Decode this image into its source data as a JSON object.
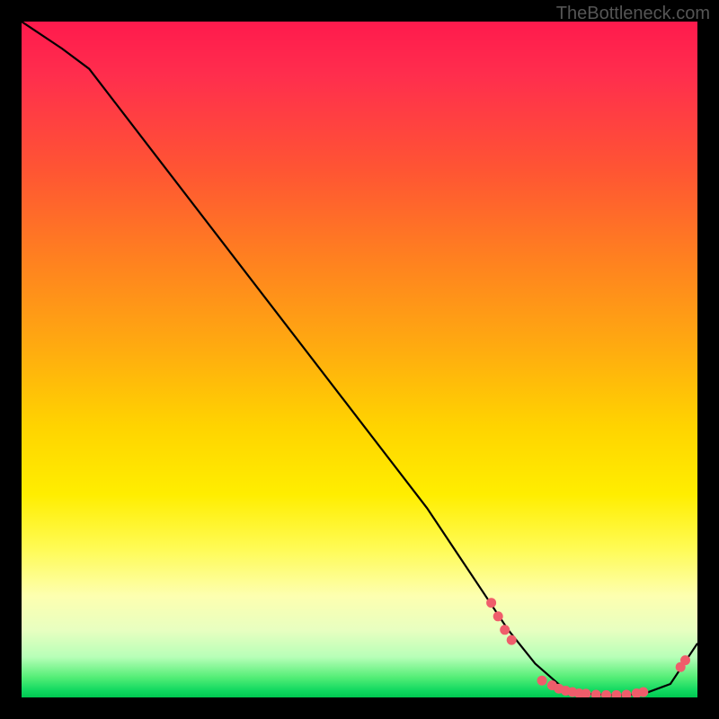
{
  "watermark": "TheBottleneck.com",
  "chart_data": {
    "type": "line",
    "title": "",
    "xlabel": "",
    "ylabel": "",
    "xlim": [
      0,
      100
    ],
    "ylim": [
      0,
      100
    ],
    "series": [
      {
        "name": "curve",
        "x": [
          0,
          6,
          10,
          20,
          30,
          40,
          50,
          60,
          68,
          72,
          76,
          80,
          84,
          88,
          92,
          96,
          100
        ],
        "y": [
          100,
          96,
          93,
          80,
          67,
          54,
          41,
          28,
          16,
          10,
          5,
          1.5,
          0.5,
          0.3,
          0.5,
          2,
          8
        ]
      }
    ],
    "markers": [
      {
        "x": 69.5,
        "y": 14.0
      },
      {
        "x": 70.5,
        "y": 12.0
      },
      {
        "x": 71.5,
        "y": 10.0
      },
      {
        "x": 72.5,
        "y": 8.5
      },
      {
        "x": 77.0,
        "y": 2.5
      },
      {
        "x": 78.5,
        "y": 1.8
      },
      {
        "x": 79.5,
        "y": 1.3
      },
      {
        "x": 80.5,
        "y": 1.0
      },
      {
        "x": 81.5,
        "y": 0.8
      },
      {
        "x": 82.5,
        "y": 0.6
      },
      {
        "x": 83.5,
        "y": 0.55
      },
      {
        "x": 85.0,
        "y": 0.4
      },
      {
        "x": 86.5,
        "y": 0.35
      },
      {
        "x": 88.0,
        "y": 0.35
      },
      {
        "x": 89.5,
        "y": 0.4
      },
      {
        "x": 91.0,
        "y": 0.6
      },
      {
        "x": 92.0,
        "y": 0.8
      },
      {
        "x": 97.5,
        "y": 4.5
      },
      {
        "x": 98.2,
        "y": 5.5
      }
    ],
    "marker_color": "#ef5d6b",
    "curve_color": "#000000"
  }
}
